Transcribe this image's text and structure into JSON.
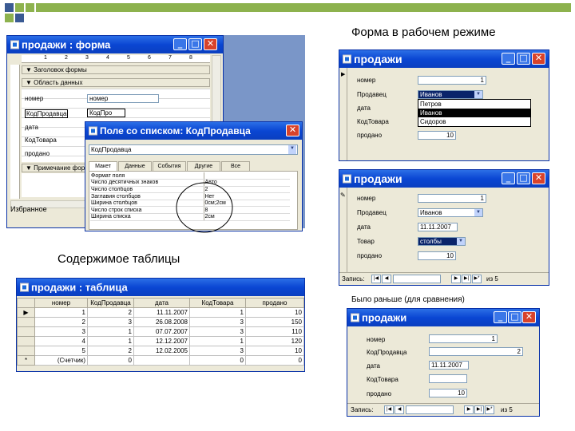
{
  "captions": {
    "form_mode": "Форма в рабочем режиме",
    "table_contents": "Содержимое таблицы",
    "before": "Было раньше (для сравнения)"
  },
  "colors": {
    "titlebar": "#0a46d3",
    "close_button": "#d8432b",
    "decor_green": "#8db24e",
    "decor_blue": "#3a5a93"
  },
  "design_window": {
    "title": "продажи : форма",
    "ruler_digits": [
      "1",
      "2",
      "3",
      "4",
      "5",
      "6",
      "7",
      "8"
    ],
    "section_header": "Заголовок формы",
    "section_detail": "Область данных",
    "section_footer": "Примечание формы",
    "fields": [
      {
        "label": "номер",
        "value": "номер"
      },
      {
        "label": "КодПродавца",
        "value": "КодПро"
      },
      {
        "label": "дата",
        "value": ""
      },
      {
        "label": "КодТовара",
        "value": ""
      },
      {
        "label": "продано",
        "value": ""
      }
    ],
    "side_item": "Избранное"
  },
  "combo_props_window": {
    "title": "Поле со списком: КодПродавца",
    "object_selector": "КодПродавца",
    "tabs": [
      "Макет",
      "Данные",
      "События",
      "Другие",
      "Все"
    ],
    "properties": [
      {
        "name": "Формат поля",
        "value": ""
      },
      {
        "name": "Число десятичных знаков",
        "value": "Авто"
      },
      {
        "name": "Число столбцов",
        "value": "2"
      },
      {
        "name": "Заглавия столбцов",
        "value": "Нет"
      },
      {
        "name": "Ширина столбцов",
        "value": "0см;2см"
      },
      {
        "name": "Число строк списка",
        "value": "8"
      },
      {
        "name": "Ширина списка",
        "value": "2см"
      }
    ]
  },
  "form_window_1": {
    "title": "продажи",
    "labels": [
      "номер",
      "Продавец",
      "дата",
      "КодТовара",
      "продано"
    ],
    "nomer": "1",
    "prodavec": "Иванов",
    "prodano": "10",
    "dropdown": [
      "Петров",
      "Иванов",
      "Сидоров"
    ]
  },
  "form_window_2": {
    "title": "продажи",
    "labels": [
      "номер",
      "Продавец",
      "дата",
      "Товар",
      "продано"
    ],
    "nomer": "1",
    "prodavec": "Иванов",
    "data": "11.11.2007",
    "tovar": "столбы",
    "prodano": "10",
    "nav_label": "Запись:",
    "nav_of": "из 5"
  },
  "table_window": {
    "title": "продажи : таблица",
    "columns": [
      "номер",
      "КодПродавца",
      "дата",
      "КодТовара",
      "продано"
    ],
    "rows": [
      {
        "marker": "▶",
        "cells": [
          "1",
          "2",
          "11.11.2007",
          "1",
          "10"
        ]
      },
      {
        "marker": "",
        "cells": [
          "2",
          "3",
          "26.08.2008",
          "3",
          "150"
        ]
      },
      {
        "marker": "",
        "cells": [
          "3",
          "1",
          "07.07.2007",
          "3",
          "110"
        ]
      },
      {
        "marker": "",
        "cells": [
          "4",
          "1",
          "12.12.2007",
          "1",
          "120"
        ]
      },
      {
        "marker": "",
        "cells": [
          "5",
          "2",
          "12.02.2005",
          "3",
          "10"
        ]
      },
      {
        "marker": "*",
        "cells": [
          "(Счетчик)",
          "0",
          "",
          "0",
          "0"
        ]
      }
    ]
  },
  "form_window_3": {
    "title": "продажи",
    "labels": [
      "номер",
      "КодПродавца",
      "дата",
      "КодТовара",
      "продано"
    ],
    "nomer": "1",
    "kodprodavca": "2",
    "data": "11.11.2007",
    "prodano": "10",
    "nav_label": "Запись:",
    "nav_of": "из 5"
  }
}
